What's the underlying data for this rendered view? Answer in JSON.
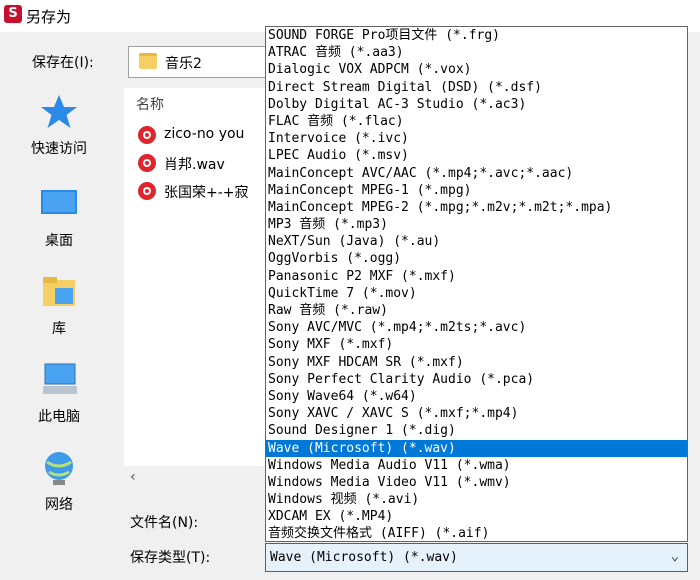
{
  "window": {
    "title": "另存为",
    "icon": "app-logo-icon",
    "icon_letter": "S"
  },
  "save_in": {
    "label": "保存在(I):",
    "value": "音乐2",
    "icon": "folder-icon"
  },
  "places": [
    {
      "label": "快速访问",
      "icon": "star-icon"
    },
    {
      "label": "桌面",
      "icon": "desktop-icon"
    },
    {
      "label": "库",
      "icon": "library-icon"
    },
    {
      "label": "此电脑",
      "icon": "computer-icon"
    },
    {
      "label": "网络",
      "icon": "network-icon"
    }
  ],
  "file_list": {
    "column_name": "名称",
    "files": [
      {
        "name": "zico-no you",
        "icon": "netease-music-icon"
      },
      {
        "name": "肖邦.wav",
        "icon": "netease-music-icon"
      },
      {
        "name": "张国荣+-+寂",
        "icon": "netease-music-icon"
      }
    ],
    "scroll_left": "‹"
  },
  "filename": {
    "label": "文件名(N):"
  },
  "filetype": {
    "label": "保存类型(T):",
    "value": "Wave (Microsoft) (*.wav)",
    "arrow": "⌄",
    "selected_index": 24,
    "options": [
      "SOUND FORGE Pro项目文件 (*.frg)",
      "ATRAC 音频 (*.aa3)",
      "Dialogic VOX ADPCM (*.vox)",
      "Direct Stream Digital (DSD) (*.dsf)",
      "Dolby Digital AC-3 Studio (*.ac3)",
      "FLAC 音频 (*.flac)",
      "Intervoice (*.ivc)",
      "LPEC Audio (*.msv)",
      "MainConcept AVC/AAC (*.mp4;*.avc;*.aac)",
      "MainConcept MPEG-1 (*.mpg)",
      "MainConcept MPEG-2 (*.mpg;*.m2v;*.m2t;*.mpa)",
      "MP3 音频 (*.mp3)",
      "NeXT/Sun (Java) (*.au)",
      "OggVorbis (*.ogg)",
      "Panasonic P2 MXF (*.mxf)",
      "QuickTime 7 (*.mov)",
      "Raw 音频 (*.raw)",
      "Sony AVC/MVC (*.mp4;*.m2ts;*.avc)",
      "Sony MXF (*.mxf)",
      "Sony MXF HDCAM SR (*.mxf)",
      "Sony Perfect Clarity Audio (*.pca)",
      "Sony Wave64 (*.w64)",
      "Sony XAVC / XAVC S (*.mxf;*.mp4)",
      "Sound Designer 1 (*.dig)",
      "Wave (Microsoft) (*.wav)",
      "Windows Media Audio V11 (*.wma)",
      "Windows Media Video V11 (*.wmv)",
      "Windows 视频 (*.avi)",
      "XDCAM EX (*.MP4)",
      "音频交换文件格式 (AIFF) (*.aif)"
    ]
  },
  "colors": {
    "selection": "#0078d7",
    "accent_red": "#c8102e"
  }
}
